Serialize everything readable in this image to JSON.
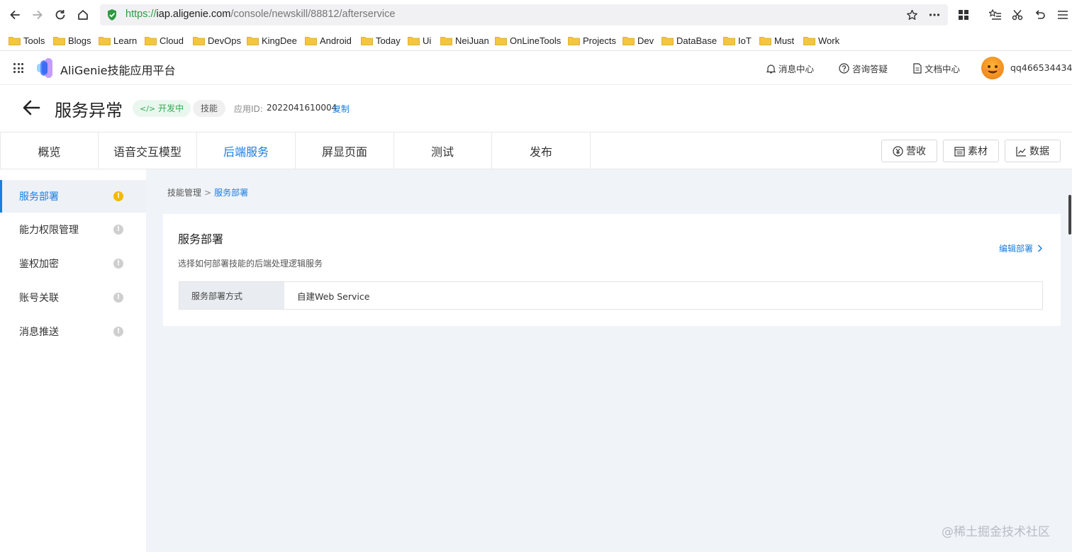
{
  "browser": {
    "url_proto": "https://",
    "url_host": "iap.aligenie.com",
    "url_path": "/console/newskill/88812/afterservice",
    "bookmarks": [
      "Tools",
      "Blogs",
      "Learn",
      "Cloud",
      "DevOps",
      "KingDee",
      "Android",
      "Today",
      "Ui",
      "NeiJuan",
      "OnLineTools",
      "Projects",
      "Dev",
      "DataBase",
      "IoT",
      "Must",
      "Work"
    ]
  },
  "header": {
    "app_title": "AliGenie技能应用平台",
    "messages": "消息中心",
    "help": "咨询答疑",
    "docs": "文档中心",
    "username": "qq466534434"
  },
  "titlebar": {
    "title": "服务异常",
    "status_tag": "开发中",
    "type_tag": "技能",
    "app_id_label": "应用ID:",
    "app_id": "2022041610004",
    "copy": "复制"
  },
  "tabs": [
    "概览",
    "语音交互模型",
    "后端服务",
    "屏显页面",
    "测试",
    "发布"
  ],
  "active_tab": "后端服务",
  "toolbar": {
    "revenue": "营收",
    "materials": "素材",
    "data": "数据"
  },
  "sidebar": {
    "items": [
      {
        "label": "服务部署",
        "badge": "!"
      },
      {
        "label": "能力权限管理",
        "badge": "!"
      },
      {
        "label": "鉴权加密",
        "badge": "!"
      },
      {
        "label": "账号关联",
        "badge": "!"
      },
      {
        "label": "消息推送",
        "badge": "!"
      }
    ]
  },
  "breadcrumb": {
    "parent": "技能管理",
    "separator": ">",
    "current": "服务部署"
  },
  "card": {
    "title": "服务部署",
    "description": "选择如何部署技能的后端处理逻辑服务",
    "edit": "编辑部署",
    "field_label": "服务部署方式",
    "field_value": "自建Web Service"
  },
  "watermark": "@稀土掘金技术社区",
  "colors": {
    "accent": "#1a7ee0",
    "warning": "#f5b800",
    "dev_tag": "#34a853"
  }
}
